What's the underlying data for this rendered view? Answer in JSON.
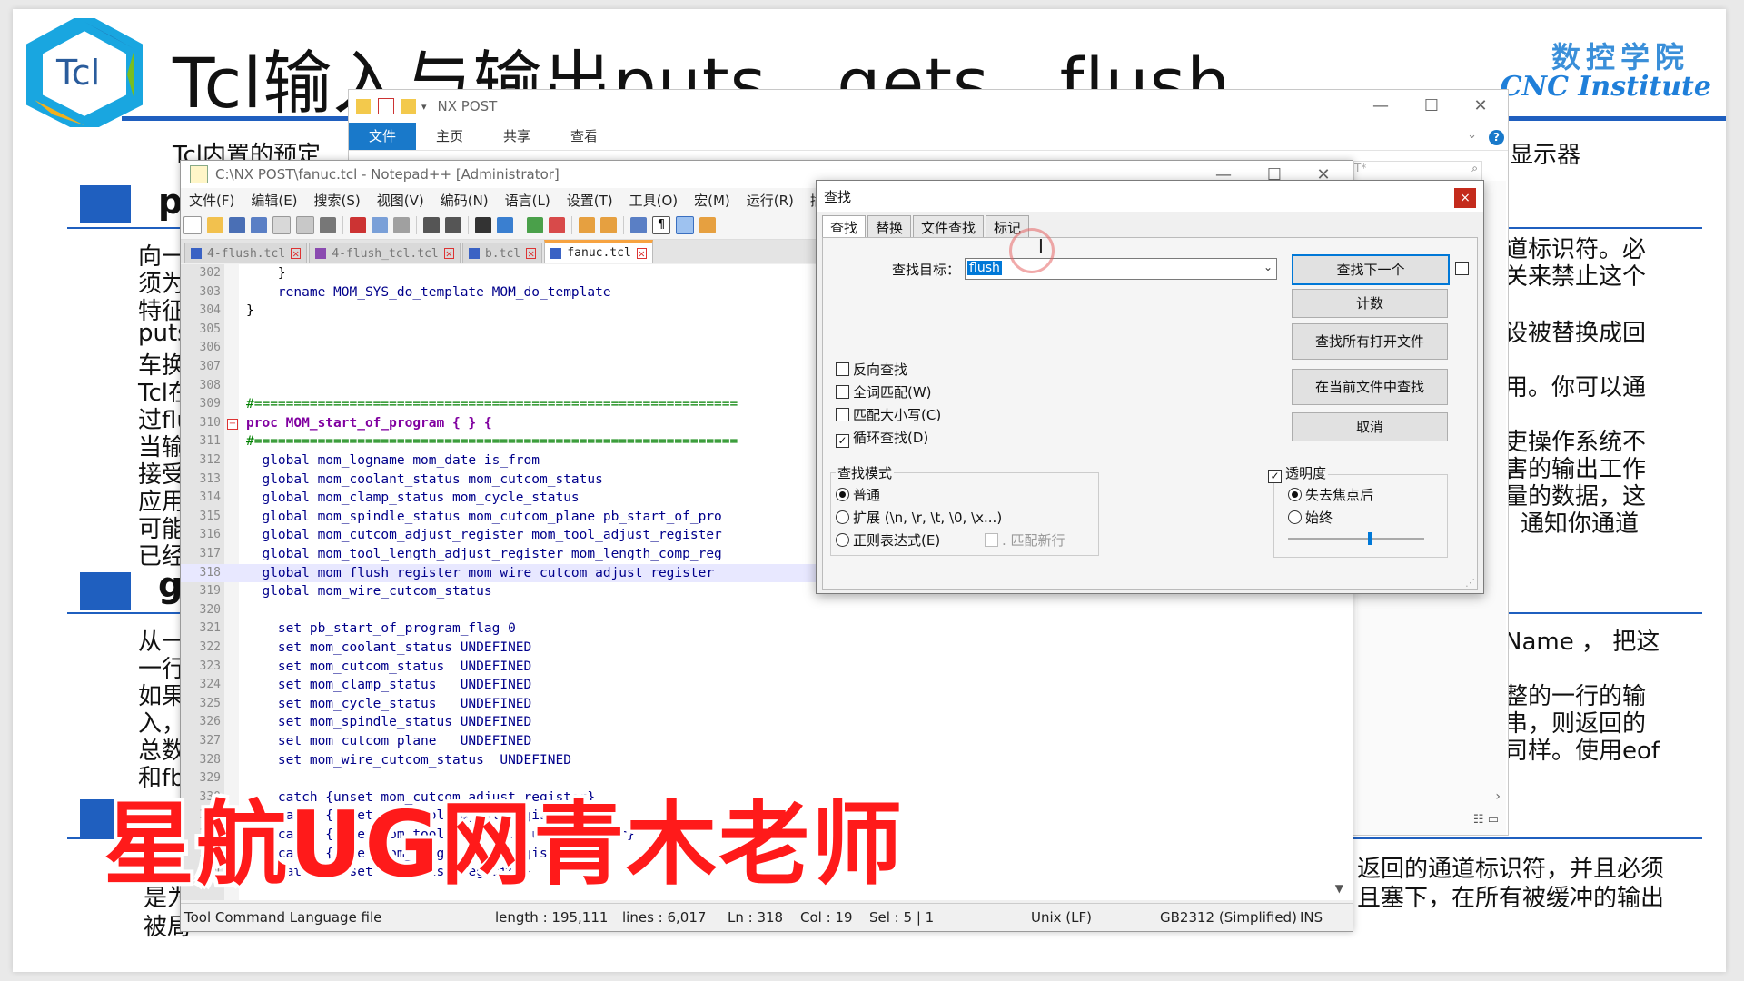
{
  "slide": {
    "logo_text": "Tcl",
    "title": "Tcl输入与输出puts、gets、flush",
    "institute_cn": "数控学院",
    "institute_en": "CNC Institute",
    "subtitle_left": "Tcl内置的预定",
    "subtitle_right": "显示器",
    "sec1_letter": "p",
    "sec2_letter": "g",
    "left_lines": [
      "向一",
      "须为",
      "特征",
      "puts",
      "车换",
      "Tcl在",
      "过flu",
      "当输",
      "接受",
      "应用",
      "可能",
      "已经"
    ],
    "left_lines2": [
      "从一",
      "一行",
      "如果",
      "入，",
      "总数",
      "和fb"
    ],
    "left_lines3": [
      "是为",
      "被局"
    ],
    "right_lines": [
      "道标识符。必",
      "关来禁止这个",
      "设被替换成回",
      "用。你可以通",
      "吏操作系统不",
      "害的输出工作",
      "量的数据，这",
      "通知你通道"
    ],
    "right_lines2": [
      "Name ， 把这",
      "整的一行的输",
      "串，则返回的",
      "司样。使用eof"
    ],
    "right_lines3": [
      "返回的通道标识符，并且必须",
      "且塞下，在所有被缓冲的输出"
    ],
    "watermark": "星航UG网青木老师"
  },
  "explorer": {
    "title": "NX POST",
    "tabs": [
      "文件",
      "主页",
      "共享",
      "查看"
    ],
    "search_hint": "T*",
    "scroll_right": "›",
    "colors": {
      "ribbon_accent": "#1979ca"
    }
  },
  "npp": {
    "title": "C:\\NX POST\\fanuc.tcl - Notepad++ [Administrator]",
    "menu": [
      "文件(F)",
      "编辑(E)",
      "搜索(S)",
      "视图(V)",
      "编码(N)",
      "语言(L)",
      "设置(T)",
      "工具(O)",
      "宏(M)",
      "运行(R)",
      "插"
    ],
    "tabs": [
      "4-flush.tcl",
      "4-flush_tcl.tcl",
      "b.tcl",
      "fanuc.tcl"
    ],
    "active_tab_index": 3,
    "lines": [
      {
        "n": "302",
        "t": "    }"
      },
      {
        "n": "303",
        "t": "    rename MOM_SYS_do_template MOM_do_template"
      },
      {
        "n": "304",
        "t": "}"
      },
      {
        "n": "305",
        "t": ""
      },
      {
        "n": "306",
        "t": ""
      },
      {
        "n": "307",
        "t": ""
      },
      {
        "n": "308",
        "t": ""
      },
      {
        "n": "309",
        "t": "#============================================================="
      },
      {
        "n": "310",
        "t": "proc MOM_start_of_program { } {"
      },
      {
        "n": "311",
        "t": "#============================================================="
      },
      {
        "n": "312",
        "t": "  global mom_logname mom_date is_from"
      },
      {
        "n": "313",
        "t": "  global mom_coolant_status mom_cutcom_status"
      },
      {
        "n": "314",
        "t": "  global mom_clamp_status mom_cycle_status"
      },
      {
        "n": "315",
        "t": "  global mom_spindle_status mom_cutcom_plane pb_start_of_pro"
      },
      {
        "n": "316",
        "t": "  global mom_cutcom_adjust_register mom_tool_adjust_register"
      },
      {
        "n": "317",
        "t": "  global mom_tool_length_adjust_register mom_length_comp_reg"
      },
      {
        "n": "318",
        "t": "  global mom_flush_register mom_wire_cutcom_adjust_register"
      },
      {
        "n": "319",
        "t": "  global mom_wire_cutcom_status"
      },
      {
        "n": "320",
        "t": ""
      },
      {
        "n": "321",
        "t": "    set pb_start_of_program_flag 0"
      },
      {
        "n": "322",
        "t": "    set mom_coolant_status UNDEFINED"
      },
      {
        "n": "323",
        "t": "    set mom_cutcom_status  UNDEFINED"
      },
      {
        "n": "324",
        "t": "    set mom_clamp_status   UNDEFINED"
      },
      {
        "n": "325",
        "t": "    set mom_cycle_status   UNDEFINED"
      },
      {
        "n": "326",
        "t": "    set mom_spindle_status UNDEFINED"
      },
      {
        "n": "327",
        "t": "    set mom_cutcom_plane   UNDEFINED"
      },
      {
        "n": "328",
        "t": "    set mom_wire_cutcom_status  UNDEFINED"
      },
      {
        "n": "329",
        "t": ""
      },
      {
        "n": "330",
        "t": "    catch {unset mom_cutcom_adjust_register}"
      },
      {
        "n": "331",
        "t": "    catch {unset mom_tool_adjust_register}"
      },
      {
        "n": "332",
        "t": "    catch {unset mom_tool_length_adjust_register}"
      },
      {
        "n": "333",
        "t": "    catch {unset mom_length_comp_register}"
      },
      {
        "n": "334",
        "t": "    catch {unset mom_flush_register}"
      }
    ],
    "current_line_index": 16,
    "status": {
      "lang": "Tool Command Language file",
      "length": "length : 195,111",
      "lines": "lines : 6,017",
      "ln": "Ln : 318",
      "col": "Col : 19",
      "sel": "Sel : 5 | 1",
      "eol": "Unix (LF)",
      "enc": "GB2312 (Simplified)",
      "ins": "INS"
    }
  },
  "find": {
    "title": "查找",
    "close": "×",
    "tabs": [
      "查找",
      "替换",
      "文件查找",
      "标记"
    ],
    "target_label": "查找目标：",
    "target_value": "flush",
    "buttons": [
      "查找下一个",
      "计数",
      "查找所有打开文件",
      "在当前文件中查找",
      "取消"
    ],
    "options": [
      {
        "label": "反向查找",
        "checked": false
      },
      {
        "label": "全词匹配(W)",
        "checked": false
      },
      {
        "label": "匹配大小写(C)",
        "checked": false
      },
      {
        "label": "循环查找(D)",
        "checked": true
      }
    ],
    "mode_title": "查找模式",
    "modes": [
      {
        "label": "普通",
        "on": true
      },
      {
        "label": "扩展 (\\n, \\r, \\t, \\0, \\x...)",
        "on": false
      },
      {
        "label": "正则表达式(E)",
        "on": false
      }
    ],
    "dot_newline": ". 匹配新行",
    "transparency_label": "透明度",
    "trans_modes": [
      {
        "label": "失去焦点后",
        "on": true
      },
      {
        "label": "始终",
        "on": false
      }
    ],
    "transparency_level": 0.6
  }
}
